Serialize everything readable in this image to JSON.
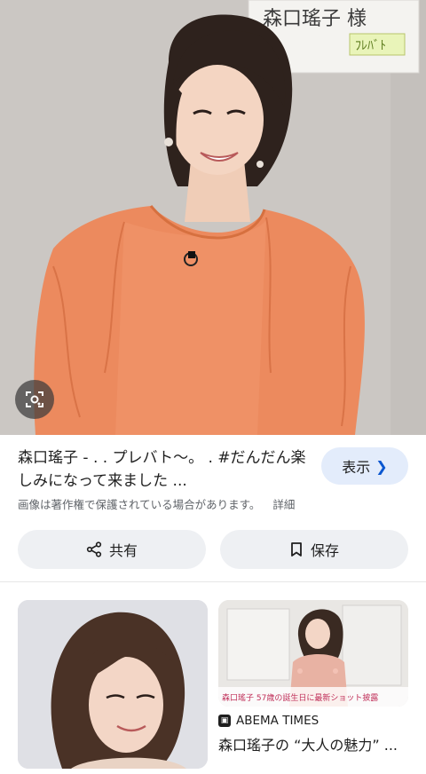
{
  "hero": {
    "sign_text": "森口瑤子 様",
    "sign_logo": "ﾌﾚﾊﾞﾄ"
  },
  "result": {
    "title": "森口瑤子 - . . プレバト〜。 . #だんだん楽しみになって来ました ...",
    "visit_label": "表示",
    "copyright_notice": "画像は著作権で保護されている場合があります。",
    "details_label": "詳細"
  },
  "actions": {
    "share_label": "共有",
    "save_label": "保存"
  },
  "related": [
    {},
    {
      "thumb_caption": "森口瑤子 57歳の誕生日に最新ショット披露",
      "source": "ABEMA TIMES",
      "title": "森口瑤子の “大人の魅力” ..."
    }
  ],
  "icons": {
    "lens": "lens-icon",
    "chevron": "chevron-right-icon",
    "share": "share-icon",
    "bookmark": "bookmark-icon",
    "abema": "abema-icon"
  },
  "colors": {
    "visit_bg": "#e3ecfb",
    "chevron": "#0b57d0",
    "action_bg": "#eef0f3",
    "dress": "#ec8a5e"
  }
}
